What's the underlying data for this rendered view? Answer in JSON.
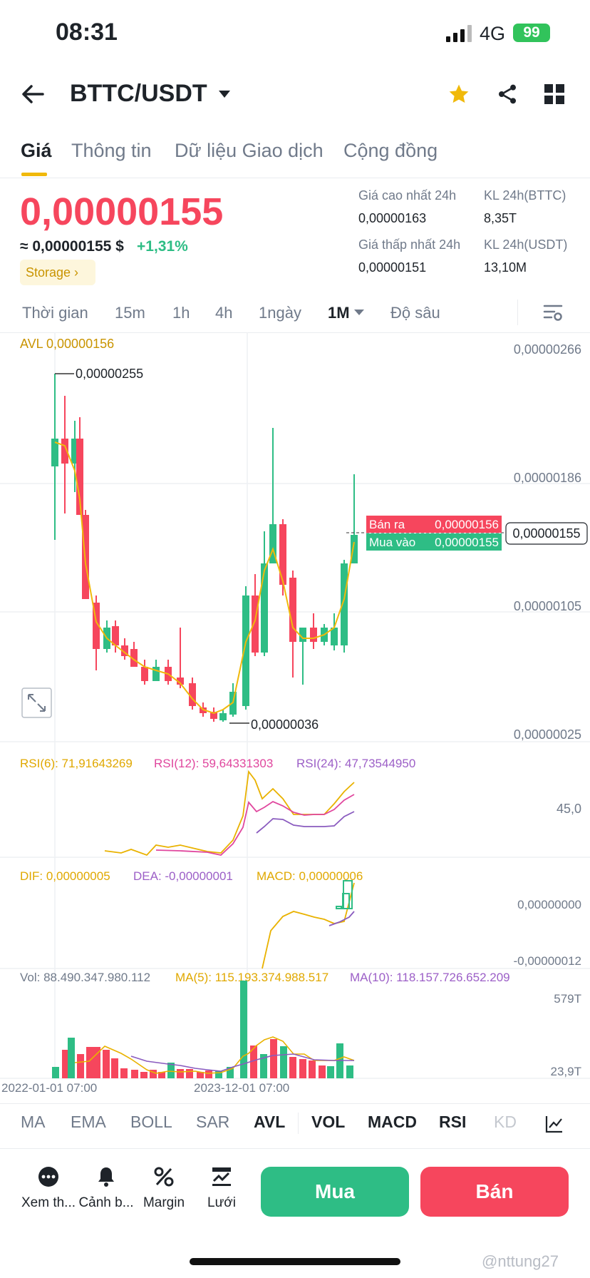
{
  "status": {
    "time": "08:31",
    "network": "4G",
    "battery": "99"
  },
  "header": {
    "pair": "BTTC/USDT"
  },
  "tabs": [
    {
      "label": "Giá",
      "active": true
    },
    {
      "label": "Thông tin"
    },
    {
      "label": "Dữ liệu Giao dịch"
    },
    {
      "label": "Cộng đồng"
    }
  ],
  "price": {
    "last": "0,00000155",
    "usd": "≈ 0,00000155 $",
    "change": "+1,31%",
    "tag": "Storage"
  },
  "stats": {
    "high_label": "Giá cao nhất 24h",
    "high_value": "0,00000163",
    "low_label": "Giá thấp nhất 24h",
    "low_value": "0,00000151",
    "vol_btt_label": "KL 24h(BTTC)",
    "vol_btt_value": "8,35T",
    "vol_usdt_label": "KL 24h(USDT)",
    "vol_usdt_value": "13,10M"
  },
  "timeframes": [
    "Thời gian",
    "15m",
    "1h",
    "4h",
    "1ngày",
    "1M",
    "Độ sâu"
  ],
  "timeframe_active": "1M",
  "chart_labels": {
    "avl": "AVL 0,00000156",
    "hi_marker": "0,00000255",
    "lo_marker": "0,00000036",
    "axis": [
      "0,00000266",
      "0,00000186",
      "0,00000105",
      "0,00000025"
    ],
    "ask_label": "Bán ra",
    "ask_value": "0,00000156",
    "bid_label": "Mua vào",
    "bid_value": "0,00000155",
    "current": "0,00000155",
    "rsi6": "RSI(6): 71,91643269",
    "rsi12": "RSI(12): 59,64331303",
    "rsi24": "RSI(24): 47,73544950",
    "rsi_axis": "45,0",
    "dif": "DIF: 0,00000005",
    "dea": "DEA: -0,00000001",
    "macd": "MACD: 0,00000006",
    "macd_axis_top": "0,00000000",
    "macd_axis_bot": "-0,00000012",
    "vol": "Vol: 88.490.347.980.112",
    "ma5": "MA(5): 115.193.374.988.517",
    "ma10": "MA(10): 118.157.726.652.209",
    "vol_axis_top": "579T",
    "vol_axis_bot": "23,9T",
    "date1": "2022-01-01 07:00",
    "date2": "2023-12-01 07:00"
  },
  "indicators": [
    "MA",
    "EMA",
    "BOLL",
    "SAR",
    "AVL",
    "VOL",
    "MACD",
    "RSI",
    "KD"
  ],
  "nav": [
    {
      "label": "Xem th...",
      "icon": "more-icon"
    },
    {
      "label": "Cảnh b...",
      "icon": "bell-icon"
    },
    {
      "label": "Margin",
      "icon": "percent-icon"
    },
    {
      "label": "Lưới",
      "icon": "grid-bot-icon"
    }
  ],
  "buy_label": "Mua",
  "sell_label": "Bán",
  "watermark": "@nttung27",
  "colors": {
    "up": "#2ebd85",
    "down": "#f6465d",
    "accent": "#f0b90b",
    "text": "#1e2329",
    "muted": "#707a8a"
  }
}
